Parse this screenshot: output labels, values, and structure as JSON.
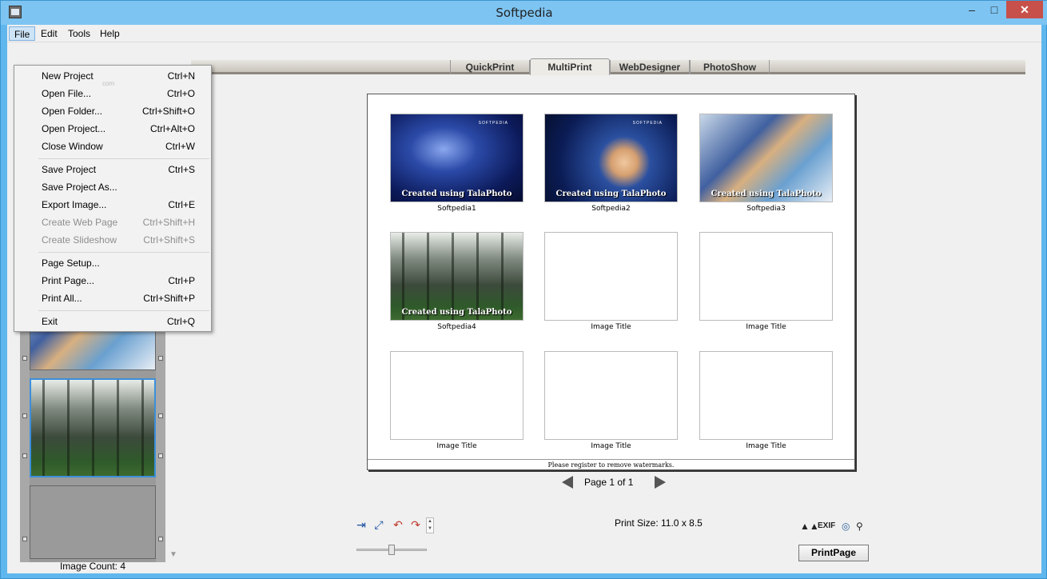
{
  "window": {
    "title": "Softpedia",
    "minimize": "–",
    "maximize": "□",
    "close": "✕"
  },
  "menubar": {
    "items": [
      "File",
      "Edit",
      "Tools",
      "Help"
    ]
  },
  "tabs": [
    "QuickPrint",
    "MultiPrint",
    "WebDesigner",
    "PhotoShow"
  ],
  "active_tab": "MultiPrint",
  "file_menu": {
    "items": [
      {
        "label": "New Project",
        "shortcut": "Ctrl+N",
        "enabled": true
      },
      {
        "label": "Open File...",
        "shortcut": "Ctrl+O",
        "enabled": true
      },
      {
        "label": "Open Folder...",
        "shortcut": "Ctrl+Shift+O",
        "enabled": true
      },
      {
        "label": "Open Project...",
        "shortcut": "Ctrl+Alt+O",
        "enabled": true
      },
      {
        "label": "Close Window",
        "shortcut": "Ctrl+W",
        "enabled": true
      },
      {
        "label": "Save Project",
        "shortcut": "Ctrl+S",
        "enabled": true
      },
      {
        "label": "Save Project As...",
        "shortcut": "",
        "enabled": true
      },
      {
        "label": "Export Image...",
        "shortcut": "Ctrl+E",
        "enabled": true
      },
      {
        "label": "Create Web Page",
        "shortcut": "Ctrl+Shift+H",
        "enabled": false
      },
      {
        "label": "Create Slideshow",
        "shortcut": "Ctrl+Shift+S",
        "enabled": false
      },
      {
        "label": "Page Setup...",
        "shortcut": "",
        "enabled": true
      },
      {
        "label": "Print Page...",
        "shortcut": "Ctrl+P",
        "enabled": true
      },
      {
        "label": "Print All...",
        "shortcut": "Ctrl+Shift+P",
        "enabled": true
      },
      {
        "label": "Exit",
        "shortcut": "Ctrl+Q",
        "enabled": true
      }
    ],
    "ghost_text": "com"
  },
  "page": {
    "watermark": "Created using TalaPhoto",
    "mini_brand": "SOFTPEDIA",
    "cells": [
      {
        "caption": "Softpedia1",
        "image": "img1"
      },
      {
        "caption": "Softpedia2",
        "image": "img2"
      },
      {
        "caption": "Softpedia3",
        "image": "img3"
      },
      {
        "caption": "Softpedia4",
        "image": "img4"
      },
      {
        "caption": "Image Title",
        "image": ""
      },
      {
        "caption": "Image Title",
        "image": ""
      },
      {
        "caption": "Image Title",
        "image": ""
      },
      {
        "caption": "Image Title",
        "image": ""
      },
      {
        "caption": "Image Title",
        "image": ""
      }
    ],
    "footer_note": "Please register to remove watermarks."
  },
  "pager": {
    "label": "Page 1 of 1"
  },
  "print_size": "Print Size: 11.0 x 8.5",
  "image_count": "Image Count: 4",
  "tools_right": {
    "exif": "EXIF"
  },
  "print_page_button": "PrintPage",
  "colors": {
    "title_bar": "#7dc4f2",
    "close_button": "#c7504a",
    "selection_border": "#3b8fd9",
    "menu_highlight": "#cde4f7"
  }
}
